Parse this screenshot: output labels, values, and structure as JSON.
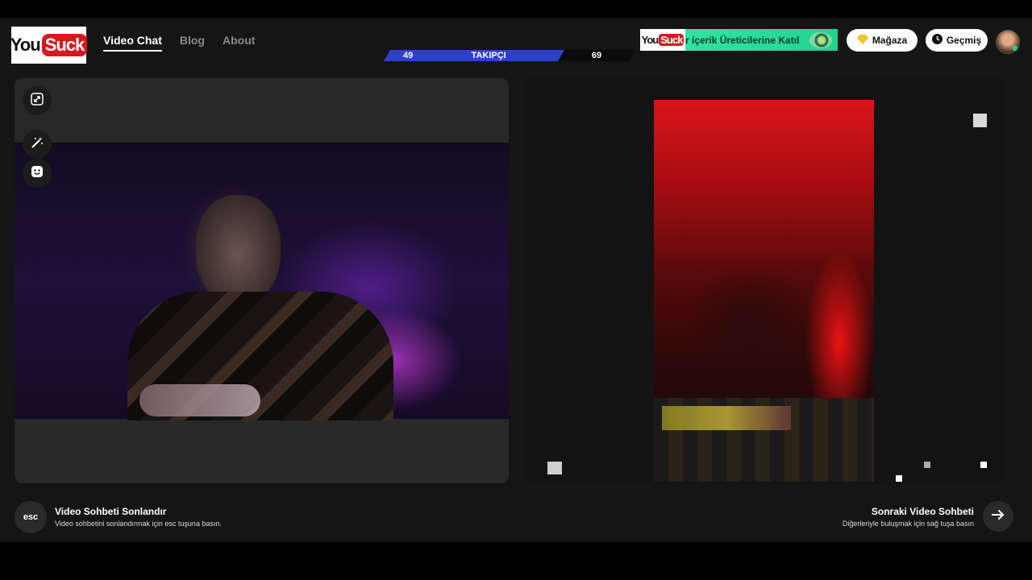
{
  "logo": {
    "part1": "You",
    "part2": "Suck"
  },
  "nav": {
    "items": [
      {
        "label": "Video Chat",
        "active": true
      },
      {
        "label": "Blog",
        "active": false
      },
      {
        "label": "About",
        "active": false
      }
    ]
  },
  "followers": {
    "left_count": "49",
    "label": "TAKIPÇI",
    "right_count": "69"
  },
  "promo": {
    "logo_part1": "You",
    "logo_part2": "Suck",
    "text": "r içerik Üreticilerine Katıl"
  },
  "header_buttons": {
    "store_label": "Mağaza",
    "store_icon": "diamond-icon",
    "history_label": "Geçmiş",
    "history_icon": "clock-icon"
  },
  "tools": {
    "expand_icon": "expand-icon",
    "effects_icon": "magic-wand-icon",
    "emoji_icon": "face-filter-icon"
  },
  "footer": {
    "esc_label": "esc",
    "end_title": "Video Sohbeti Sonlandır",
    "end_sub": "Video sohbetini sonlandırmak için esc tuşuna basın.",
    "next_title": "Sonraki Video Sohbeti",
    "next_sub": "Diğerleriyle buluşmak için sağ tuşa basın",
    "next_icon": "arrow-right-icon"
  },
  "colors": {
    "accent_blue": "#2f3fd0",
    "promo_green": "#2ad99a",
    "brand_red": "#d7191e"
  }
}
